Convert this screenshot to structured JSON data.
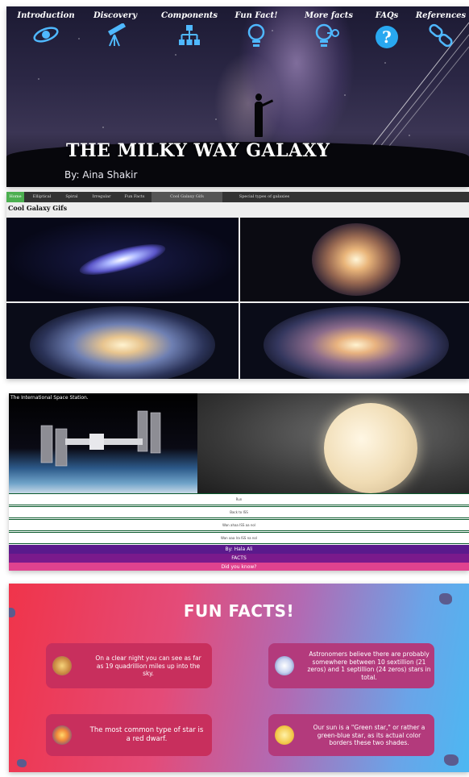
{
  "header": {
    "nav": [
      {
        "label": "Introduction",
        "icon": "galaxy-icon"
      },
      {
        "label": "Discovery",
        "icon": "telescope-icon"
      },
      {
        "label": "Components",
        "icon": "hierarchy-icon"
      },
      {
        "label": "Fun Fact!",
        "icon": "lightbulb-icon"
      },
      {
        "label": "More facts",
        "icon": "idea-key-icon"
      },
      {
        "label": "FAQs",
        "icon": "question-icon"
      },
      {
        "label": "References",
        "icon": "link-icon"
      }
    ],
    "title": "THE MILKY WAY GALAXY",
    "author": "By: Aina Shakir"
  },
  "gifs": {
    "tabs": [
      "Home",
      "Elliptical",
      "Spiral",
      "Irregular",
      "Fun Facts",
      "Cool Galaxy Gifs",
      "Special types of galaxies"
    ],
    "active_tab": "Home",
    "heading": "Cool Galaxy Gifs"
  },
  "iss": {
    "caption": "The International Space Station.",
    "rows": [
      "Run",
      "Back to ISS",
      "Wan ahaa ISS aa nol",
      "Wan aaa lra ISS na nol"
    ],
    "bars": [
      {
        "label": "By: Hala Ali",
        "color": "#5a1a8c"
      },
      {
        "label": "FACTS",
        "color": "#7a1a8c"
      },
      {
        "label": "Did you know?",
        "color": "#e0428f"
      }
    ]
  },
  "fun_facts": {
    "title": "FUN FACTS!",
    "facts": [
      {
        "text": "On a clear night you can see as far as 19 quadrillion miles up into the sky.",
        "icon": "hamburger-planet-icon"
      },
      {
        "text": "Astronomers believe there are probably somewhere between 10 sextillion (21 zeros) and 1 septillion (24 zeros) stars in total.",
        "icon": "observatory-icon"
      },
      {
        "text": "The most common type of star is a red dwarf.",
        "icon": "rocket-icon"
      },
      {
        "text": "Our sun is a \"Green star,\" or rather a green-blue star, as its actual color borders these two shades.",
        "icon": "moon-icon"
      }
    ]
  }
}
